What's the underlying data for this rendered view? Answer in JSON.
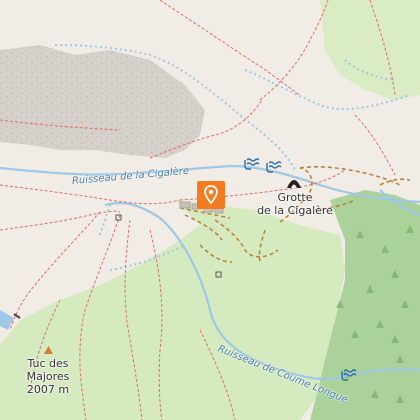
{
  "map": {
    "labels": {
      "cave": "Grotte\nde la Cigalère",
      "cave_line1": "Grotte",
      "cave_line2": "de la Cigalère",
      "peak_name_line1": "Tuc des",
      "peak_name_line2": "Majores",
      "peak_elevation": "2007 m",
      "stream_1": "Ruisseau de la Cigalère",
      "stream_2": "Ruisseau de Coume Longue"
    },
    "icons": {
      "marker": "map-pin-icon",
      "cave": "cave-icon",
      "peak": "peak-triangle-icon",
      "spring": "spring-icon"
    },
    "colors": {
      "land": "#f1ede6",
      "rock": "#d7d2cb",
      "meadow": "#d8ecc1",
      "forest": "#acd29a",
      "water": "#9fc7e6",
      "water_text": "#4a7fa8",
      "path": "#e06a6a",
      "track": "#b5873a",
      "marker": "#f47b20"
    }
  }
}
